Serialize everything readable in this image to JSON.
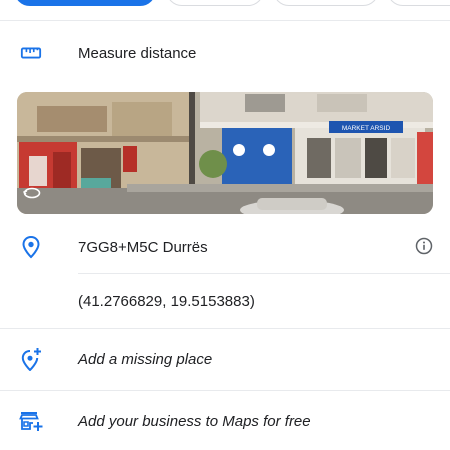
{
  "rows": {
    "measure": {
      "label": "Measure distance",
      "icon": "ruler-icon"
    },
    "address": {
      "plus_code": "7GG8+M5C Durrës",
      "icon": "location-pin-icon",
      "info_icon": "info-icon"
    },
    "coords": {
      "value": "(41.2766829, 19.5153883)"
    },
    "missing": {
      "label": "Add a missing place",
      "icon": "add-place-icon"
    },
    "business": {
      "label": "Add your business to Maps for free",
      "icon": "add-business-icon"
    }
  },
  "street_view": {
    "sign_text": "MARKET ARSID",
    "icon": "rotate-360-icon"
  },
  "colors": {
    "accent": "#1a73e8",
    "text": "#202124",
    "divider": "#e8eaed"
  }
}
